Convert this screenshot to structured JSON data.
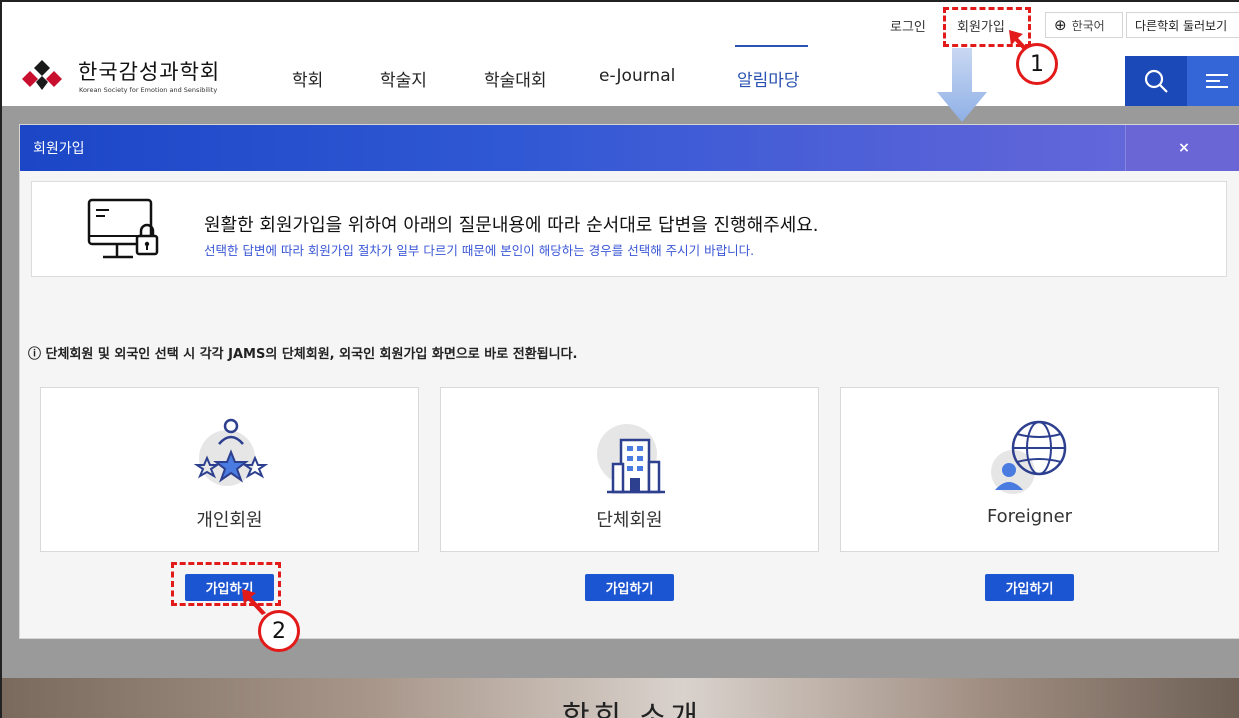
{
  "utility": {
    "login": "로그인",
    "join": "회원가입",
    "language": "한국어",
    "other_societies": "다른학회 둘러보기"
  },
  "header": {
    "logo_ko": "한국감성과학회",
    "logo_en": "Korean Society for Emotion and Sensibility",
    "nav": [
      "학회",
      "학술지",
      "학술대회",
      "e-Journal",
      "알림마당"
    ],
    "active_nav": "알림마당"
  },
  "modal": {
    "title": "회원가입",
    "close": "×",
    "info_main": "원활한 회원가입을 위하여 아래의 질문내용에 따라 순서대로 답변을 진행해주세요.",
    "info_sub": "선택한 답변에 따라 회원가입 절차가 일부 다르기 때문에 본인이 해당하는 경우를 선택해 주시기 바랍니다.",
    "notice": "ⓘ 단체회원 및 외국인 선택 시 각각 JAMS의 단체회원, 외국인 회원가입 화면으로 바로 전환됩니다.",
    "cards": [
      {
        "label": "개인회원",
        "icon": "person-stars-icon",
        "button": "가입하기"
      },
      {
        "label": "단체회원",
        "icon": "building-icon",
        "button": "가입하기"
      },
      {
        "label": "Foreigner",
        "icon": "globe-person-icon",
        "button": "가입하기"
      }
    ]
  },
  "background": {
    "heading": "학회 소개"
  },
  "annotations": {
    "step1": "1",
    "step2": "2"
  },
  "colors": {
    "accent": "#1c55d2",
    "header_gradient_start": "#1b46c6",
    "header_gradient_end": "#6a6cdc",
    "callout": "#e21a1a"
  }
}
